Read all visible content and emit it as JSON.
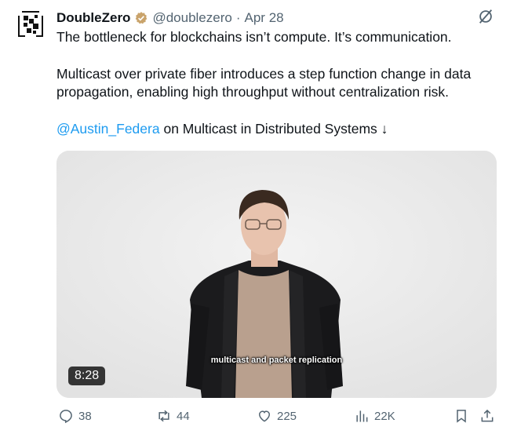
{
  "tweet": {
    "display_name": "DoubleZero",
    "handle": "@doublezero",
    "separator": "·",
    "date": "Apr 28",
    "line1": "The bottleneck for blockchains isn’t compute. It’s communication.",
    "line2": "Multicast over private fiber introduces a step function change in data propagation, enabling high throughput without centralization risk.",
    "mention": "@Austin_Federa",
    "line3_rest": " on Multicast in Distributed Systems ↓"
  },
  "video": {
    "caption": "multicast and packet replication",
    "duration": "8:28"
  },
  "actions": {
    "replies": "38",
    "reposts": "44",
    "likes": "225",
    "views": "22K"
  },
  "icons": {
    "avatar": "doublezero-logo-icon",
    "verified": "verified-badge-icon",
    "grok": "grok-icon",
    "reply": "reply-icon",
    "repost": "repost-icon",
    "like": "heart-icon",
    "views": "views-icon",
    "bookmark": "bookmark-icon",
    "share": "share-icon"
  },
  "colors": {
    "link": "#1d9bf0",
    "muted": "#536471",
    "verified": "#c9a36b"
  }
}
